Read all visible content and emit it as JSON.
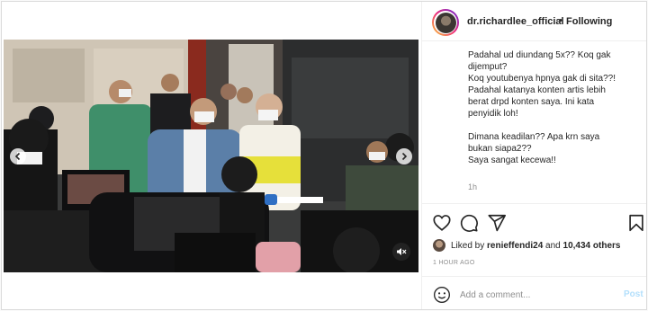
{
  "post": {
    "username": "dr.richardlee_official",
    "separator": "•",
    "follow_status": "Following",
    "caption_lines": [
      "Padahal ud diundang 5x?? Koq gak",
      "dijemput?",
      "Koq youtubenya hpnya gak di sita??!",
      "Padahal katanya konten artis lebih",
      "berat drpd konten saya. Ini kata",
      "penyidik loh!",
      "",
      "Dimana keadilan?? Apa krn saya",
      "bukan siapa2??",
      "Saya sangat kecewa!!"
    ],
    "caption_age": "1h",
    "likes": {
      "prefix": "Liked by ",
      "liker": "renieffendi24",
      "middle": " and ",
      "others": "10,434 others"
    },
    "timestamp": "1 HOUR AGO"
  },
  "comment": {
    "placeholder": "Add a comment...",
    "post_label": "Post"
  },
  "icons": {
    "like": "heart-icon",
    "comment": "comment-icon",
    "share": "paper-plane-icon",
    "save": "bookmark-icon",
    "emoji": "smiley-icon",
    "prev": "chevron-left-icon",
    "next": "chevron-right-icon",
    "mute": "speaker-muted-icon"
  },
  "colors": {
    "text": "#262626",
    "secondary": "#8e8e8e",
    "post_button_disabled": "#b2dffc",
    "border": "#dbdbdb"
  }
}
